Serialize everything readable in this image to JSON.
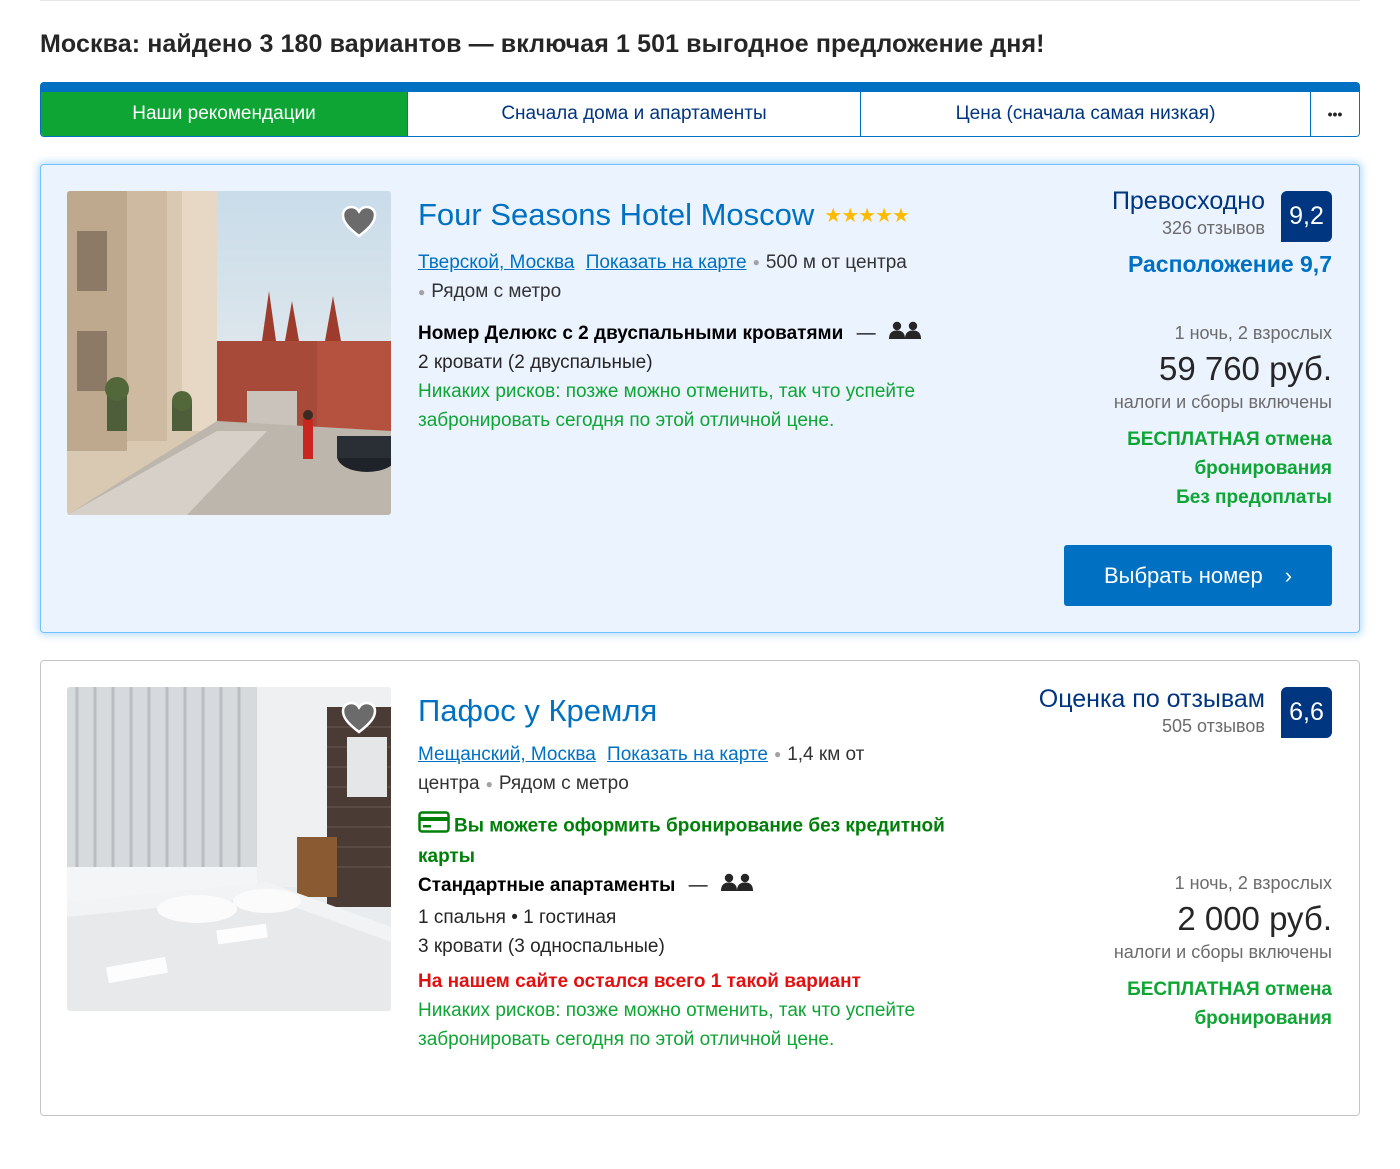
{
  "heading": "Москва: найдено 3 180 вариантов — включая 1 501 выгодное предложение дня!",
  "sort_tabs": [
    {
      "label": "Наши рекомендации",
      "active": true
    },
    {
      "label": "Сначала дома и апартаменты",
      "active": false
    },
    {
      "label": "Цена (сначала самая низкая)",
      "active": false
    },
    {
      "label": "•••",
      "active": false
    }
  ],
  "hotels": [
    {
      "name": "Four Seasons Hotel Moscow",
      "stars": "★★★★★",
      "district": "Тверской, Москва",
      "map_link": "Показать на карте",
      "distance": "500 м от центра",
      "metro": "Рядом с метро",
      "room_name": "Номер Делюкс с 2 двуспальными кроватями",
      "dash": "—",
      "beds": "2 кровати (2 двуспальные)",
      "no_risk": "Никаких рисков: позже можно отменить, так что успейте забронировать сегодня по этой отличной цене.",
      "score_word": "Превосходно",
      "reviews": "326 отзывов",
      "score": "9,2",
      "location_score": "Расположение 9,7",
      "nights": "1 ночь, 2 взрослых",
      "price": "59 760 руб.",
      "taxes": "налоги и сборы включены",
      "free_cancel_1": "БЕСПЛАТНАЯ отмена",
      "free_cancel_2": "бронирования",
      "no_prepay": "Без предоплаты",
      "cta": "Выбрать номер"
    },
    {
      "name": "Пафос у Кремля",
      "district": "Мещанский, Москва",
      "map_link": "Показать на карте",
      "distance": "1,4 км от центра",
      "metro": "Рядом с метро",
      "no_card": "Вы можете оформить бронирование без кредитной карты",
      "room_name": "Стандартные апартаменты",
      "dash": "—",
      "rooms": "1 спальня • 1 гостиная",
      "beds": "3 кровати (3 односпальные)",
      "last_one": "На нашем сайте остался всего 1 такой вариант",
      "no_risk": "Никаких рисков: позже можно отменить, так что успейте забронировать сегодня по этой отличной цене.",
      "score_word": "Оценка по отзывам",
      "reviews": "505 отзывов",
      "score": "6,6",
      "nights": "1 ночь, 2 взрослых",
      "price": "2 000 руб.",
      "taxes": "налоги и сборы включены",
      "free_cancel_1": "БЕСПЛАТНАЯ отмена",
      "free_cancel_2": "бронирования"
    }
  ],
  "colors": {
    "brand_blue": "#0071c2",
    "dark_blue": "#003580",
    "green": "#0ea534",
    "dark_green": "#008009",
    "red": "#e21111",
    "star_yellow": "#febb02",
    "highlight_bg": "#ebf3ff"
  },
  "icons": [
    "heart-icon",
    "people-icon",
    "credit-card-icon",
    "chevron-right-icon",
    "more-dots-icon",
    "star-icon"
  ]
}
